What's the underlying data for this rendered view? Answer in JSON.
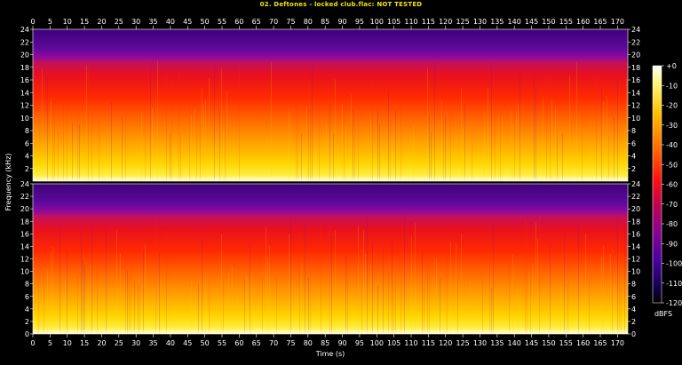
{
  "chart_data": {
    "type": "heatmap",
    "title": "02. Deftones - locked club.flac: NOT TESTED",
    "xlabel": "Time (s)",
    "ylabel": "Frequency (kHz)",
    "colorbar_label": "dBFS",
    "x_ticks": [
      "0",
      "5",
      "10",
      "15",
      "20",
      "25",
      "30",
      "35",
      "40",
      "45",
      "50",
      "55",
      "60",
      "65",
      "70",
      "75",
      "80",
      "85",
      "90",
      "95",
      "100",
      "105",
      "110",
      "115",
      "120",
      "125",
      "130",
      "135",
      "140",
      "145",
      "150",
      "155",
      "160",
      "165",
      "170"
    ],
    "y_ticks_channel_1": [
      "24",
      "22",
      "20",
      "18",
      "16",
      "14",
      "12",
      "10",
      "8",
      "6",
      "4",
      "2"
    ],
    "y_ticks_channel_2": [
      "24",
      "22",
      "20",
      "18",
      "16",
      "14",
      "12",
      "10",
      "8",
      "6",
      "4",
      "2",
      "0"
    ],
    "colorbar_ticks": [
      "+0",
      "-10",
      "-20",
      "-30",
      "-40",
      "-50",
      "-60",
      "-70",
      "-80",
      "-90",
      "-100",
      "-110",
      "-120"
    ],
    "xlim": [
      0,
      173
    ],
    "ylim_khz": [
      0,
      24
    ],
    "colorbar_range_db": [
      -120,
      0
    ],
    "channels": 2,
    "colors": {
      "title": "#f3e600",
      "axis": "#ffffff",
      "background": "#000000"
    }
  }
}
